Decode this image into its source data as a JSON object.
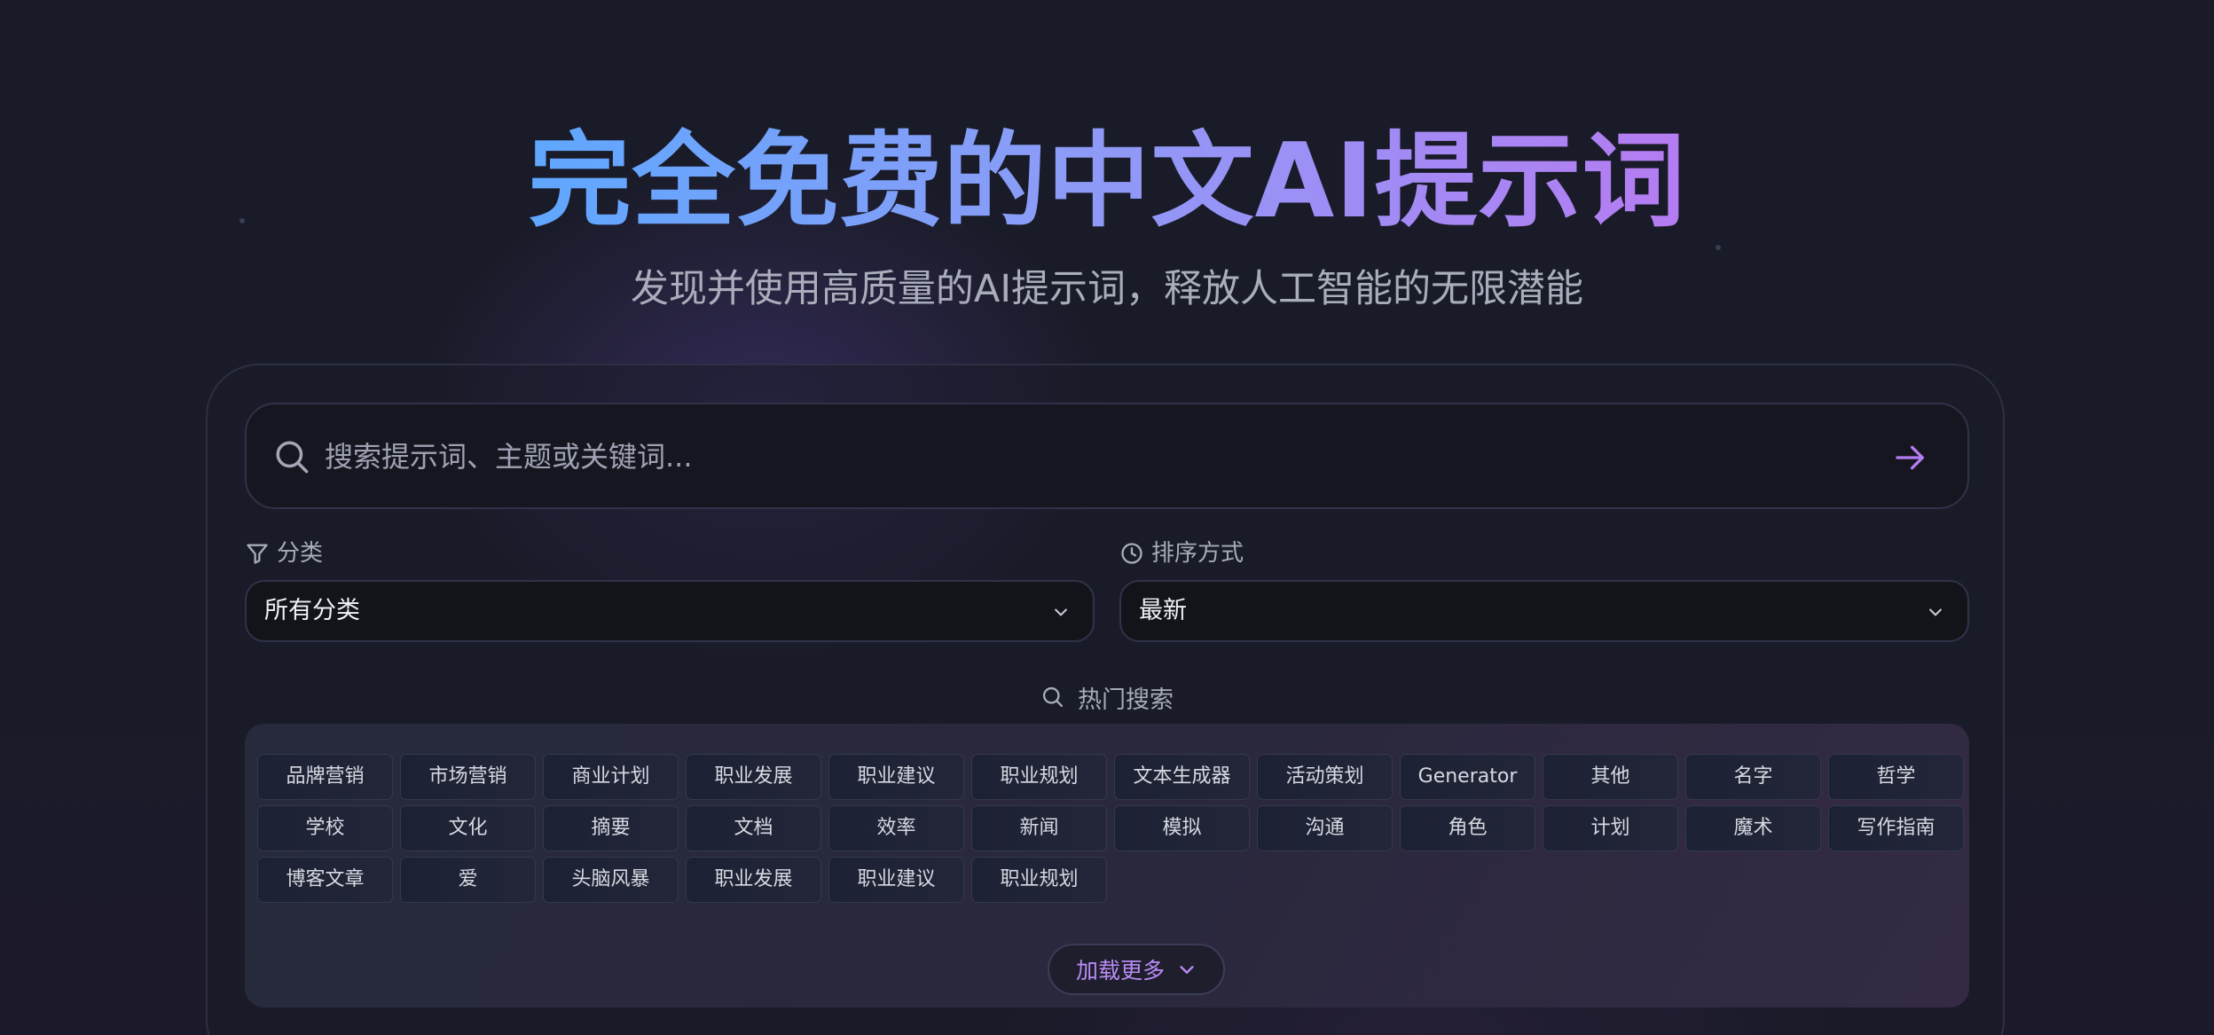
{
  "hero": {
    "title": "完全免费的中文AI提示词",
    "subtitle": "发现并使用高质量的AI提示词，释放人工智能的无限潜能"
  },
  "search": {
    "placeholder": "搜索提示词、主题或关键词...",
    "value": ""
  },
  "filters": {
    "category_label": "分类",
    "category_value": "所有分类",
    "sort_label": "排序方式",
    "sort_value": "最新"
  },
  "hot": {
    "title": "热门搜索",
    "tags": [
      "品牌营销",
      "市场营销",
      "商业计划",
      "职业发展",
      "职业建议",
      "职业规划",
      "文本生成器",
      "活动策划",
      "Generator",
      "其他",
      "名字",
      "哲学",
      "学校",
      "文化",
      "摘要",
      "文档",
      "效率",
      "新闻",
      "模拟",
      "沟通",
      "角色",
      "计划",
      "魔术",
      "写作指南",
      "博客文章",
      "爱",
      "头脑风暴",
      "职业发展",
      "职业建议",
      "职业规划"
    ],
    "load_more": "加载更多"
  },
  "colors": {
    "accent": "#b57cf2",
    "title_gradient_start": "#5fa7ff",
    "title_gradient_end": "#b57cf2",
    "background": "#181a26"
  },
  "icons": {
    "search": "search-icon",
    "submit": "arrow-right-icon",
    "category": "filter-icon",
    "sort": "clock-icon",
    "dropdown": "chevron-down-icon"
  }
}
